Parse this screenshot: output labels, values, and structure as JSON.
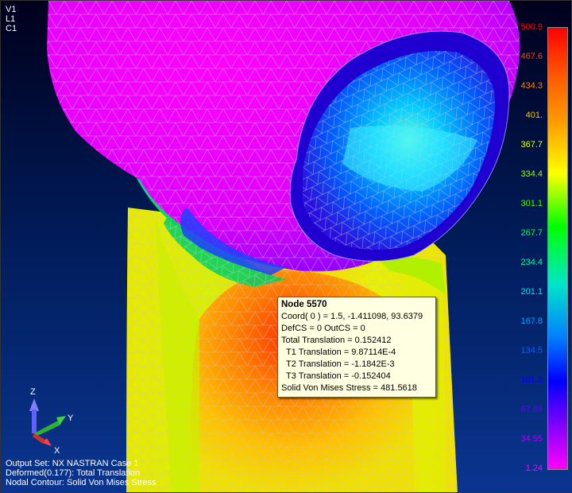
{
  "view_ids": [
    "V1",
    "L1",
    "C1"
  ],
  "legend": {
    "values": [
      "500.9",
      "467.6",
      "434.3",
      "401.",
      "367.7",
      "334.4",
      "301.1",
      "267.7",
      "234.4",
      "201.1",
      "167.8",
      "134.5",
      "101.2",
      "67.89",
      "34.55",
      "1.24"
    ],
    "colors": [
      "#ff0000",
      "#ff4000",
      "#ff8000",
      "#ffc000",
      "#e6ff00",
      "#9cff00",
      "#40ff00",
      "#00ff40",
      "#00ffa0",
      "#00e6e6",
      "#00a0ff",
      "#0060ff",
      "#0000ff",
      "#6000ff",
      "#b000ff",
      "#ff00ff"
    ]
  },
  "tooltip": {
    "title": "Node 5570",
    "lines": [
      "Coord( 0 ) = 1.5, -1.411098, 93.6379",
      "DefCS = 0  OutCS = 0",
      "Total Translation = 0.152412",
      "T1 Translation = 9.87114E-4",
      "T2 Translation = -1.1842E-3",
      "T3 Translation = -0.152404",
      "Solid Von Mises Stress = 481.5618"
    ]
  },
  "status": {
    "line1": "Output Set: NX NASTRAN Case 1",
    "line2": "Deformed(0.177): Total Translation",
    "line3": "Nodal Contour: Solid Von Mises Stress"
  },
  "triad": {
    "z": "Z",
    "y": "Y",
    "x": "X"
  }
}
